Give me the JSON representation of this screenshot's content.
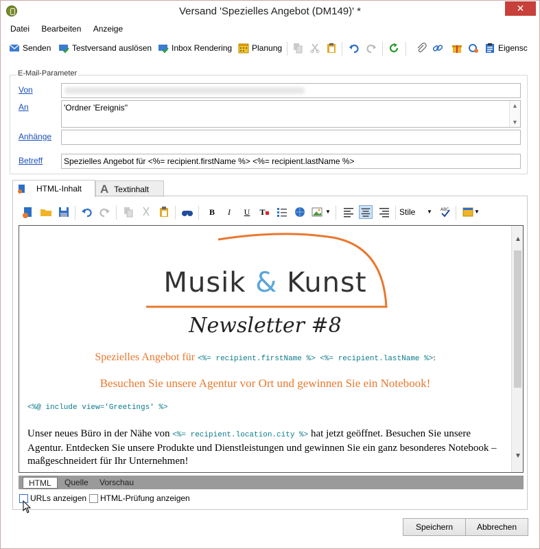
{
  "window": {
    "title": "Versand 'Spezielles Angebot (DM149)' *",
    "close_label": "✕"
  },
  "menu": {
    "items": [
      "Datei",
      "Bearbeiten",
      "Anzeige"
    ]
  },
  "toolbar": {
    "send": "Senden",
    "test_send": "Testversand auslösen",
    "inbox": "Inbox Rendering",
    "planning": "Planung",
    "properties": "Eigensc"
  },
  "email_params": {
    "legend": "E-Mail-Parameter",
    "from_label": "Von",
    "to_label": "An",
    "to_value": "'Ordner 'Ereignis''",
    "attachments_label": "Anhänge",
    "attachments_value": "",
    "subject_label": "Betreff",
    "subject_value": "Spezielles Angebot für <%= recipient.firstName %> <%= recipient.lastName %>"
  },
  "content_tabs": {
    "html": "HTML-Inhalt",
    "text": "Textinhalt"
  },
  "editor_toolbar": {
    "style_label": "Stile"
  },
  "document": {
    "logo_word1": "Musik",
    "logo_amp": "&",
    "logo_word2": "Kunst",
    "newsletter": "Newsletter #8",
    "offer_prefix": "Spezielles Angebot für",
    "offer_code": "<%= recipient.firstName %> <%= recipient.lastName %>",
    "offer_suffix": ":",
    "visit_line": "Besuchen Sie unsere Agentur vor Ort und gewinnen Sie ein Notebook!",
    "include_code": "<%@ include view='Greetings' %>",
    "para_before": "Unser neues Büro in der Nähe von",
    "para_code": "<%= recipient.location.city %>",
    "para_after": "hat jetzt geöffnet. Besuchen Sie unsere Agentur. Entdecken Sie unsere Produkte und Dienstleistungen und gewinnen Sie ein ganz besonderes Notebook – maßgeschneidert für Ihr Unternehmen!"
  },
  "bottom_tabs": [
    "HTML",
    "Quelle",
    "Vorschau"
  ],
  "options": {
    "show_urls": "URLs anzeigen",
    "show_html_check": "HTML-Prüfung anzeigen"
  },
  "buttons": {
    "save": "Speichern",
    "cancel": "Abbrechen"
  },
  "colors": {
    "accent_orange": "#e8782e",
    "link_blue": "#1a4fb8",
    "close_red": "#c7403a"
  }
}
